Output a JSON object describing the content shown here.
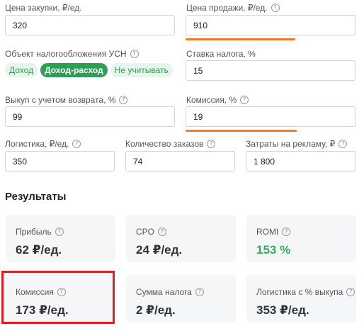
{
  "fields": {
    "purchase_price": {
      "label": "Цена закупки, ₽/ед.",
      "value": "320"
    },
    "sale_price": {
      "label": "Цена продажи, ₽/ед.",
      "value": "910"
    },
    "tax_object": {
      "label": "Объект налогообложения УСН",
      "options": [
        "Доход",
        "Доход-расход",
        "Не учитывать"
      ],
      "selected": "Доход-расход"
    },
    "tax_rate": {
      "label": "Ставка налога, %",
      "value": "15"
    },
    "buyout": {
      "label": "Выкуп с учетом возврата, %",
      "value": "99"
    },
    "commission": {
      "label": "Комиссия, %",
      "value": "19"
    },
    "logistics": {
      "label": "Логистика, ₽/ед.",
      "value": "350"
    },
    "orders": {
      "label": "Количество заказов",
      "value": "74"
    },
    "ad_costs": {
      "label": "Затраты на рекламу, ₽",
      "value": "1 800"
    }
  },
  "results": {
    "title": "Результаты",
    "cards": [
      {
        "label": "Прибыль",
        "value": "62 ₽/ед."
      },
      {
        "label": "CPO",
        "value": "24 ₽/ед."
      },
      {
        "label": "ROMI",
        "value": "153 %"
      },
      {
        "label": "Комиссия",
        "value": "173 ₽/ед."
      },
      {
        "label": "Сумма налога",
        "value": "2 ₽/ед."
      },
      {
        "label": "Логистика с % выкупа",
        "value": "353 ₽/ед."
      }
    ]
  },
  "icons": {
    "help": "?"
  },
  "colors": {
    "accent_green": "#2f9e55",
    "underline_orange": "#f07b2b",
    "highlight_red": "#e02020"
  }
}
